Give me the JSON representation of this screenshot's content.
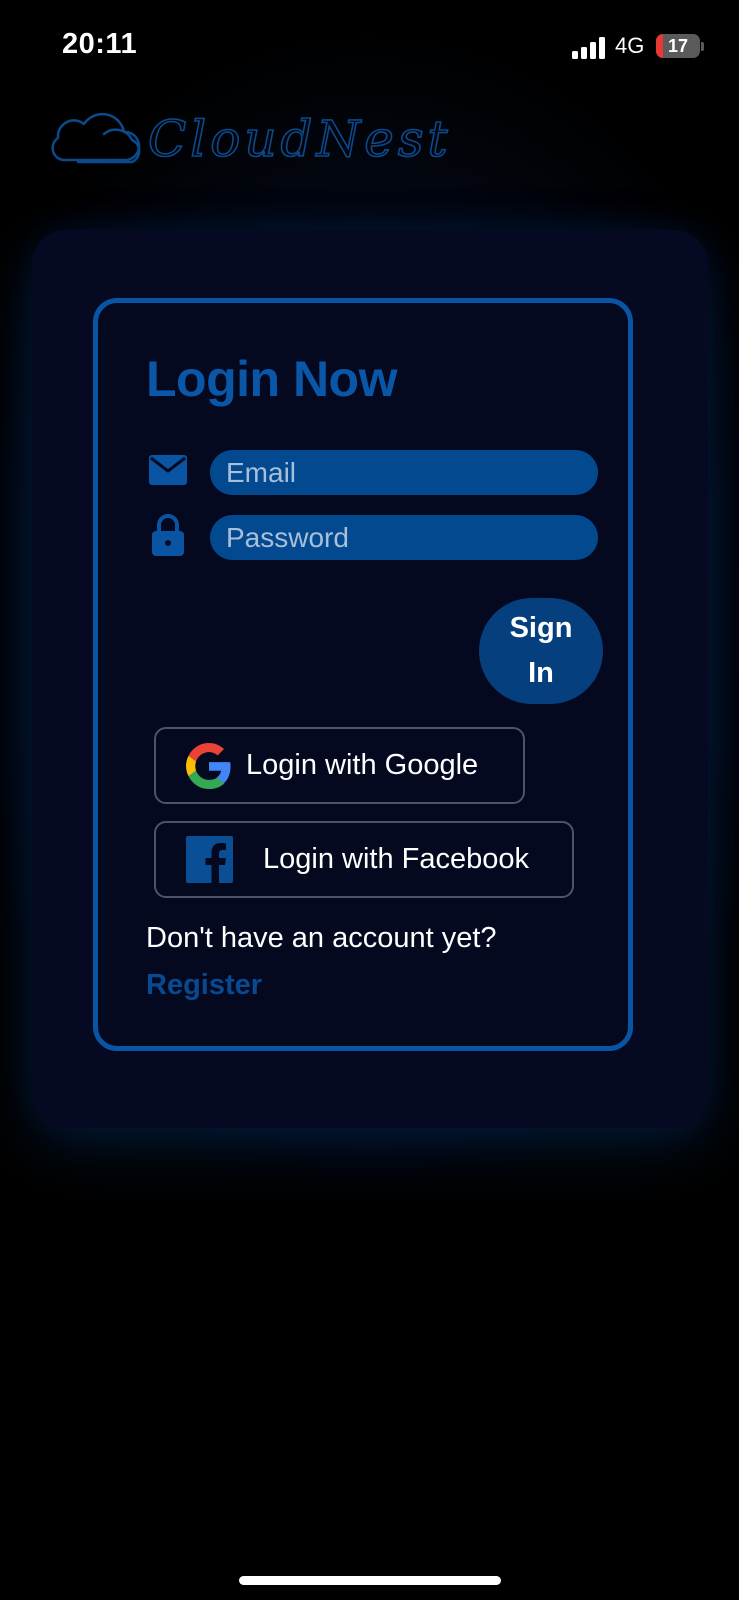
{
  "status_bar": {
    "time": "20:11",
    "network": "4G",
    "battery": "17",
    "battery_level": 0.17,
    "signal_bars": 4
  },
  "brand": {
    "name": "CloudNest",
    "logo_icon": "cloud-icon"
  },
  "login": {
    "title": "Login Now",
    "email": {
      "placeholder": "Email",
      "value": "",
      "icon": "mail-icon"
    },
    "password": {
      "placeholder": "Password",
      "value": "",
      "icon": "lock-icon"
    },
    "signin_line1": "Sign",
    "signin_line2": "In",
    "google_label": "Login with Google",
    "google_icon": "google-logo-icon",
    "facebook_label": "Login with Facebook",
    "facebook_icon": "facebook-logo-icon",
    "no_account_text": "Don't have an account yet?",
    "register_label": "Register"
  },
  "colors": {
    "accent": "#0a55a3",
    "field_bg": "#02498f",
    "signin_bg": "#063f7e",
    "panel_bg": "#050a22",
    "register_text": "#074a92"
  }
}
